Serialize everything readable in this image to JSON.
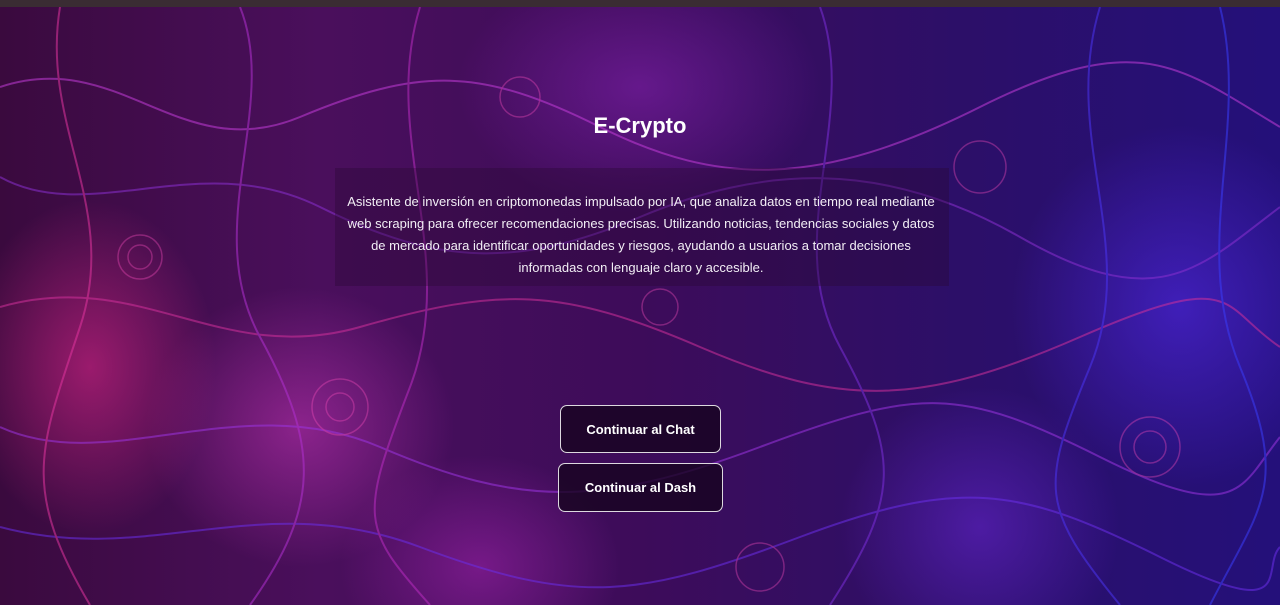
{
  "app": {
    "title": "E-Crypto",
    "description": "Asistente de inversión en criptomonedas impulsado por IA, que analiza datos en tiempo real mediante web scraping para ofrecer recomendaciones precisas. Utilizando noticias, tendencias sociales y datos de mercado para identificar oportunidades y riesgos, ayudando a usuarios a tomar decisiones informadas con lenguaje claro y accesible."
  },
  "actions": {
    "chat_label": "Continuar al Chat",
    "dash_label": "Continuar al Dash"
  },
  "colors": {
    "background_base": "#3d0c5a",
    "accent_magenta": "#e628a0",
    "accent_violet": "#5028e6",
    "button_bg": "#16041e",
    "text": "#ffffff"
  }
}
